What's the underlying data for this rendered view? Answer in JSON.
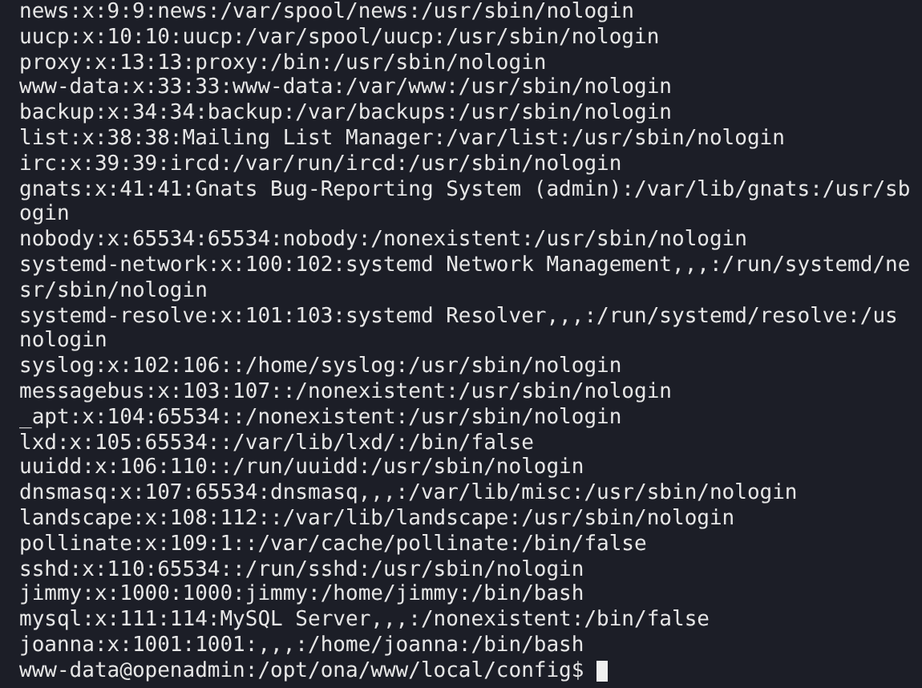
{
  "terminal": {
    "lines": [
      "news:x:9:9:news:/var/spool/news:/usr/sbin/nologin",
      "uucp:x:10:10:uucp:/var/spool/uucp:/usr/sbin/nologin",
      "proxy:x:13:13:proxy:/bin:/usr/sbin/nologin",
      "www-data:x:33:33:www-data:/var/www:/usr/sbin/nologin",
      "backup:x:34:34:backup:/var/backups:/usr/sbin/nologin",
      "list:x:38:38:Mailing List Manager:/var/list:/usr/sbin/nologin",
      "irc:x:39:39:ircd:/var/run/ircd:/usr/sbin/nologin",
      "gnats:x:41:41:Gnats Bug-Reporting System (admin):/var/lib/gnats:/usr/sb",
      "ogin",
      "nobody:x:65534:65534:nobody:/nonexistent:/usr/sbin/nologin",
      "systemd-network:x:100:102:systemd Network Management,,,:/run/systemd/ne",
      "sr/sbin/nologin",
      "systemd-resolve:x:101:103:systemd Resolver,,,:/run/systemd/resolve:/us",
      "nologin",
      "syslog:x:102:106::/home/syslog:/usr/sbin/nologin",
      "messagebus:x:103:107::/nonexistent:/usr/sbin/nologin",
      "_apt:x:104:65534::/nonexistent:/usr/sbin/nologin",
      "lxd:x:105:65534::/var/lib/lxd/:/bin/false",
      "uuidd:x:106:110::/run/uuidd:/usr/sbin/nologin",
      "dnsmasq:x:107:65534:dnsmasq,,,:/var/lib/misc:/usr/sbin/nologin",
      "landscape:x:108:112::/var/lib/landscape:/usr/sbin/nologin",
      "pollinate:x:109:1::/var/cache/pollinate:/bin/false",
      "sshd:x:110:65534::/run/sshd:/usr/sbin/nologin",
      "jimmy:x:1000:1000:jimmy:/home/jimmy:/bin/bash",
      "mysql:x:111:114:MySQL Server,,,:/nonexistent:/bin/false",
      "joanna:x:1001:1001:,,,:/home/joanna:/bin/bash"
    ],
    "prompt": "www-data@openadmin:/opt/ona/www/local/config$"
  }
}
